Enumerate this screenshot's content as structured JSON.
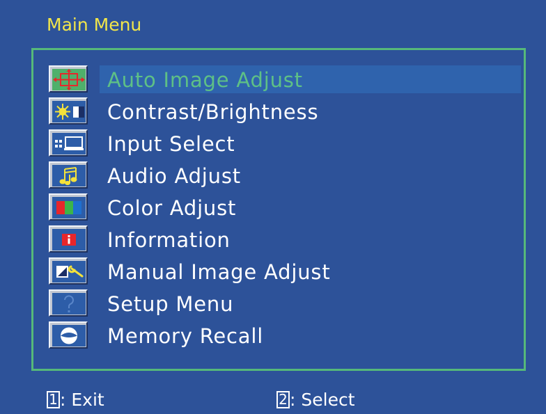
{
  "osd": {
    "title": "Main Menu",
    "selected_index": 0,
    "items": [
      {
        "label": "Auto Image Adjust",
        "icon": "auto-adjust-icon"
      },
      {
        "label": "Contrast/Brightness",
        "icon": "contrast-brightness-icon"
      },
      {
        "label": "Input Select",
        "icon": "input-select-icon"
      },
      {
        "label": "Audio Adjust",
        "icon": "audio-icon"
      },
      {
        "label": "Color Adjust",
        "icon": "color-adjust-icon"
      },
      {
        "label": "Information",
        "icon": "information-icon"
      },
      {
        "label": "Manual Image Adjust",
        "icon": "manual-adjust-icon"
      },
      {
        "label": "Setup Menu",
        "icon": "setup-icon"
      },
      {
        "label": "Memory Recall",
        "icon": "memory-recall-icon"
      }
    ],
    "footer": {
      "exit_key": "1",
      "exit_label": ": Exit",
      "select_key": "2",
      "select_label": ": Select"
    }
  },
  "colors": {
    "background": "#2d5299",
    "title": "#f2e64a",
    "border": "#56b97a",
    "selected_text": "#5ec086",
    "highlight": "#2f63ad"
  }
}
